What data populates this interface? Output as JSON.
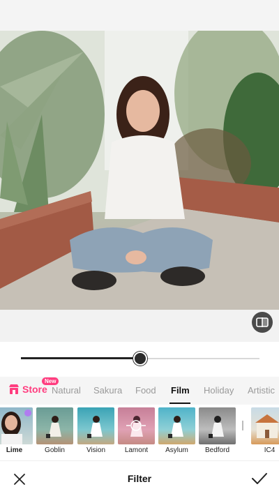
{
  "editor": {
    "title": "Filter",
    "intensity_percent": 50
  },
  "store": {
    "label": "Store",
    "badge": "New",
    "accent": "#ff3d7f"
  },
  "tabs": [
    {
      "label": "Natural",
      "active": false
    },
    {
      "label": "Sakura",
      "active": false
    },
    {
      "label": "Food",
      "active": false
    },
    {
      "label": "Film",
      "active": true
    },
    {
      "label": "Holiday",
      "active": false
    },
    {
      "label": "Artistic",
      "active": false
    }
  ],
  "filters": [
    {
      "label": "Lime",
      "selected": true
    },
    {
      "label": "Goblin",
      "selected": false
    },
    {
      "label": "Vision",
      "selected": false
    },
    {
      "label": "Lamont",
      "selected": false
    },
    {
      "label": "Asylum",
      "selected": false
    },
    {
      "label": "Bedford",
      "selected": false
    },
    {
      "label": "IC4",
      "selected": false
    }
  ],
  "icons": {
    "compare": "compare-icon",
    "close": "close-icon",
    "confirm": "checkmark-icon"
  }
}
